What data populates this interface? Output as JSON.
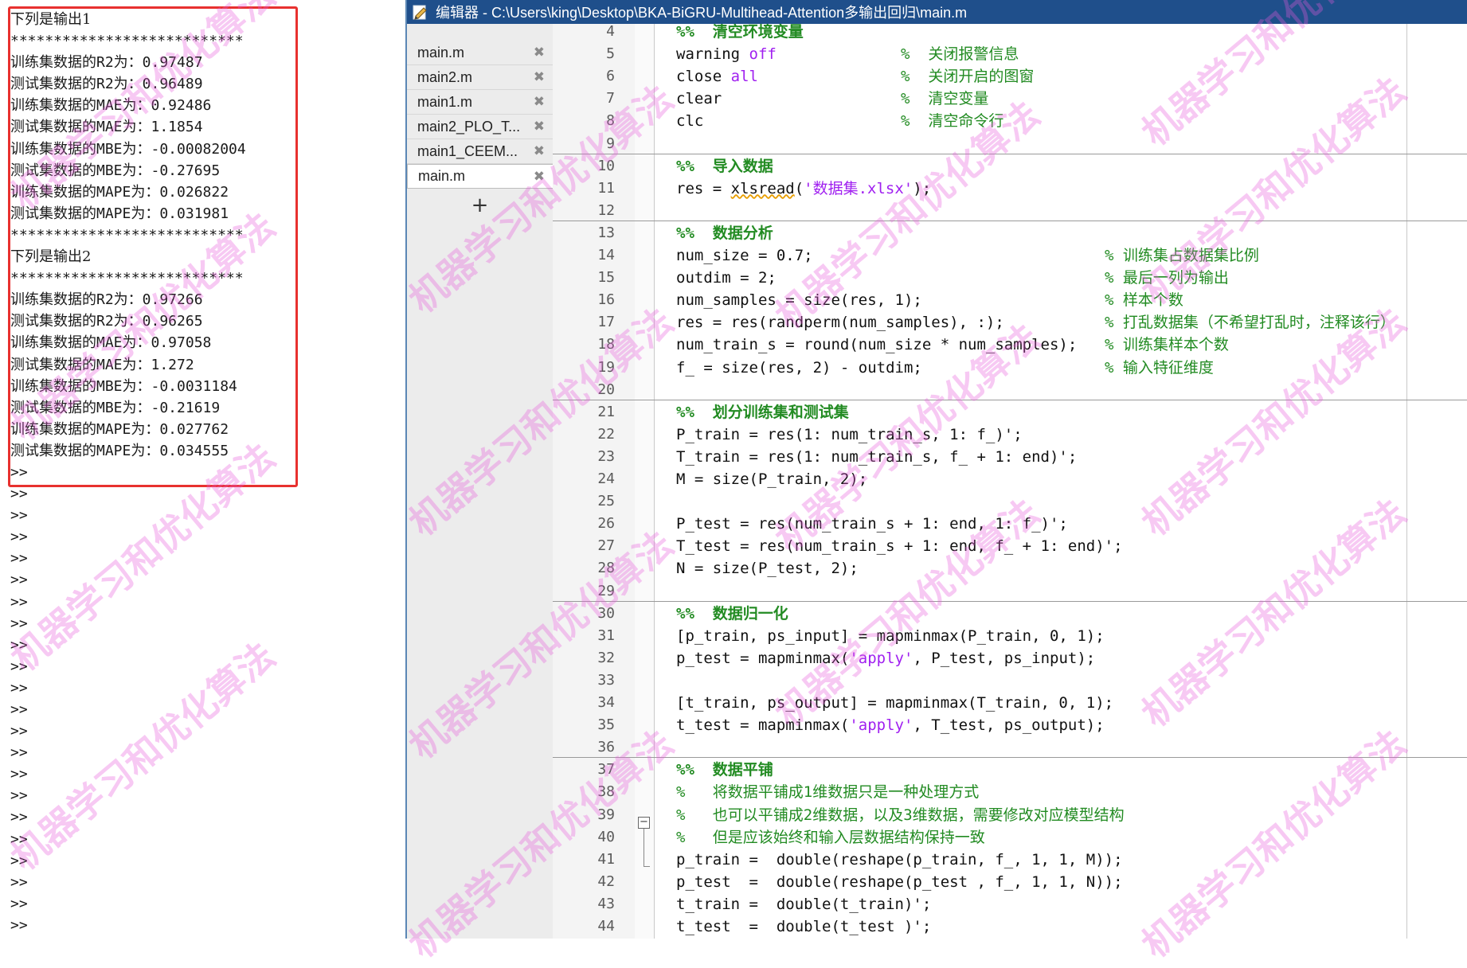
{
  "command_window": {
    "lines": [
      {
        "text": "下列是输出1",
        "kind": "title"
      },
      {
        "text": "***************************",
        "kind": "mono"
      },
      {
        "text": "训练集数据的R2为：0.97487",
        "kind": "mono"
      },
      {
        "text": "测试集数据的R2为：0.96489",
        "kind": "mono"
      },
      {
        "text": "训练集数据的MAE为：0.92486",
        "kind": "mono"
      },
      {
        "text": "测试集数据的MAE为：1.1854",
        "kind": "mono"
      },
      {
        "text": "训练集数据的MBE为：-0.00082004",
        "kind": "mono"
      },
      {
        "text": "测试集数据的MBE为：-0.27695",
        "kind": "mono"
      },
      {
        "text": "训练集数据的MAPE为：0.026822",
        "kind": "mono"
      },
      {
        "text": "测试集数据的MAPE为：0.031981",
        "kind": "mono"
      },
      {
        "text": "***************************",
        "kind": "mono"
      },
      {
        "text": "下列是输出2",
        "kind": "title"
      },
      {
        "text": "***************************",
        "kind": "mono"
      },
      {
        "text": "训练集数据的R2为：0.97266",
        "kind": "mono"
      },
      {
        "text": "测试集数据的R2为：0.96265",
        "kind": "mono"
      },
      {
        "text": "训练集数据的MAE为：0.97058",
        "kind": "mono"
      },
      {
        "text": "测试集数据的MAE为：1.272",
        "kind": "mono"
      },
      {
        "text": "训练集数据的MBE为：-0.0031184",
        "kind": "mono"
      },
      {
        "text": "测试集数据的MBE为：-0.21619",
        "kind": "mono"
      },
      {
        "text": "训练集数据的MAPE为：0.027762",
        "kind": "mono"
      },
      {
        "text": "测试集数据的MAPE为：0.034555",
        "kind": "mono"
      },
      {
        "text": ">>",
        "kind": "prompt"
      },
      {
        "text": ">>",
        "kind": "prompt"
      },
      {
        "text": ">>",
        "kind": "prompt"
      },
      {
        "text": ">>",
        "kind": "prompt"
      },
      {
        "text": ">>",
        "kind": "prompt"
      },
      {
        "text": ">>",
        "kind": "prompt"
      },
      {
        "text": ">>",
        "kind": "prompt"
      },
      {
        "text": ">>",
        "kind": "prompt"
      },
      {
        "text": ">>",
        "kind": "prompt"
      },
      {
        "text": ">>",
        "kind": "prompt"
      },
      {
        "text": ">>",
        "kind": "prompt"
      },
      {
        "text": ">>",
        "kind": "prompt"
      },
      {
        "text": ">>",
        "kind": "prompt"
      },
      {
        "text": ">>",
        "kind": "prompt"
      },
      {
        "text": ">>",
        "kind": "prompt"
      },
      {
        "text": ">>",
        "kind": "prompt"
      },
      {
        "text": ">>",
        "kind": "prompt"
      },
      {
        "text": ">>",
        "kind": "prompt"
      },
      {
        "text": ">>",
        "kind": "prompt"
      },
      {
        "text": ">>",
        "kind": "prompt"
      },
      {
        "text": ">>",
        "kind": "prompt"
      },
      {
        "text": ">>",
        "kind": "prompt"
      },
      {
        "text": ">>",
        "kind": "prompt"
      }
    ],
    "highlight_color": "#e8312f"
  },
  "editor": {
    "title": "编辑器 - C:\\Users\\king\\Desktop\\BKA-BiGRU-Multihead-Attention多输出回归\\main.m",
    "tabs": [
      {
        "label": "main.m",
        "active": false
      },
      {
        "label": "main2.m",
        "active": false
      },
      {
        "label": "main1.m",
        "active": false
      },
      {
        "label": "main2_PLO_T...",
        "active": false
      },
      {
        "label": "main1_CEEM...",
        "active": false
      },
      {
        "label": "main.m",
        "active": true
      }
    ],
    "add_tab_label": "+",
    "code_lines": [
      {
        "n": "4",
        "src": "%%  清空环境变量",
        "type": "section"
      },
      {
        "n": "5",
        "src": "warning off",
        "type": "code",
        "comment": "%  关闭报警信息",
        "ccol": 282
      },
      {
        "n": "6",
        "src": "close all",
        "type": "code",
        "comment": "%  关闭开启的图窗",
        "ccol": 282
      },
      {
        "n": "7",
        "src": "clear",
        "type": "code",
        "comment": "%  清空变量",
        "ccol": 282
      },
      {
        "n": "8",
        "src": "clc",
        "type": "code",
        "comment": "%  清空命令行",
        "ccol": 282
      },
      {
        "n": "9",
        "src": "",
        "type": "blank"
      },
      {
        "n": "10",
        "src": "%%  导入数据",
        "type": "section"
      },
      {
        "n": "11",
        "src": "res = xlsread('数据集.xlsx');",
        "type": "code"
      },
      {
        "n": "12",
        "src": "",
        "type": "blank"
      },
      {
        "n": "13",
        "src": "%%  数据分析",
        "type": "section"
      },
      {
        "n": "14",
        "src": "num_size = 0.7;",
        "type": "code",
        "comment": "% 训练集占数据集比例",
        "ccol": 538
      },
      {
        "n": "15",
        "src": "outdim = 2;",
        "type": "code",
        "comment": "% 最后一列为输出",
        "ccol": 538
      },
      {
        "n": "16",
        "src": "num_samples = size(res, 1);",
        "type": "code",
        "comment": "% 样本个数",
        "ccol": 538
      },
      {
        "n": "17",
        "src": "res = res(randperm(num_samples), :);",
        "type": "code",
        "comment": "% 打乱数据集（不希望打乱时，注释该行）",
        "ccol": 538
      },
      {
        "n": "18",
        "src": "num_train_s = round(num_size * num_samples);",
        "type": "code",
        "comment": "% 训练集样本个数",
        "ccol": 538
      },
      {
        "n": "19",
        "src": "f_ = size(res, 2) - outdim;",
        "type": "code",
        "comment": "% 输入特征维度",
        "ccol": 538
      },
      {
        "n": "20",
        "src": "",
        "type": "blank"
      },
      {
        "n": "21",
        "src": "%%  划分训练集和测试集",
        "type": "section"
      },
      {
        "n": "22",
        "src": "P_train = res(1: num_train_s, 1: f_)';",
        "type": "code"
      },
      {
        "n": "23",
        "src": "T_train = res(1: num_train_s, f_ + 1: end)';",
        "type": "code"
      },
      {
        "n": "24",
        "src": "M = size(P_train, 2);",
        "type": "code"
      },
      {
        "n": "25",
        "src": "",
        "type": "blank"
      },
      {
        "n": "26",
        "src": "P_test = res(num_train_s + 1: end, 1: f_)';",
        "type": "code"
      },
      {
        "n": "27",
        "src": "T_test = res(num_train_s + 1: end, f_ + 1: end)';",
        "type": "code"
      },
      {
        "n": "28",
        "src": "N = size(P_test, 2);",
        "type": "code"
      },
      {
        "n": "29",
        "src": "",
        "type": "blank"
      },
      {
        "n": "30",
        "src": "%%  数据归一化",
        "type": "section"
      },
      {
        "n": "31",
        "src": "[p_train, ps_input] = mapminmax(P_train, 0, 1);",
        "type": "code"
      },
      {
        "n": "32",
        "src": "p_test = mapminmax('apply', P_test, ps_input);",
        "type": "code"
      },
      {
        "n": "33",
        "src": "",
        "type": "blank"
      },
      {
        "n": "34",
        "src": "[t_train, ps_output] = mapminmax(T_train, 0, 1);",
        "type": "code"
      },
      {
        "n": "35",
        "src": "t_test = mapminmax('apply', T_test, ps_output);",
        "type": "code"
      },
      {
        "n": "36",
        "src": "",
        "type": "blank"
      },
      {
        "n": "37",
        "src": "%%  数据平铺",
        "type": "section"
      },
      {
        "n": "38",
        "src": "%   将数据平铺成1维数据只是一种处理方式",
        "type": "comment"
      },
      {
        "n": "39",
        "src": "%   也可以平铺成2维数据，以及3维数据，需要修改对应模型结构",
        "type": "comment"
      },
      {
        "n": "40",
        "src": "%   但是应该始终和输入层数据结构保持一致",
        "type": "comment"
      },
      {
        "n": "41",
        "src": "p_train =  double(reshape(p_train, f_, 1, 1, M));",
        "type": "code"
      },
      {
        "n": "42",
        "src": "p_test  =  double(reshape(p_test , f_, 1, 1, N));",
        "type": "code"
      },
      {
        "n": "43",
        "src": "t_train =  double(t_train)';",
        "type": "code"
      },
      {
        "n": "44",
        "src": "t_test  =  double(t_test )';",
        "type": "code"
      }
    ]
  },
  "watermark": {
    "text": "机器学习和优化算法",
    "color": "#e85adc"
  }
}
